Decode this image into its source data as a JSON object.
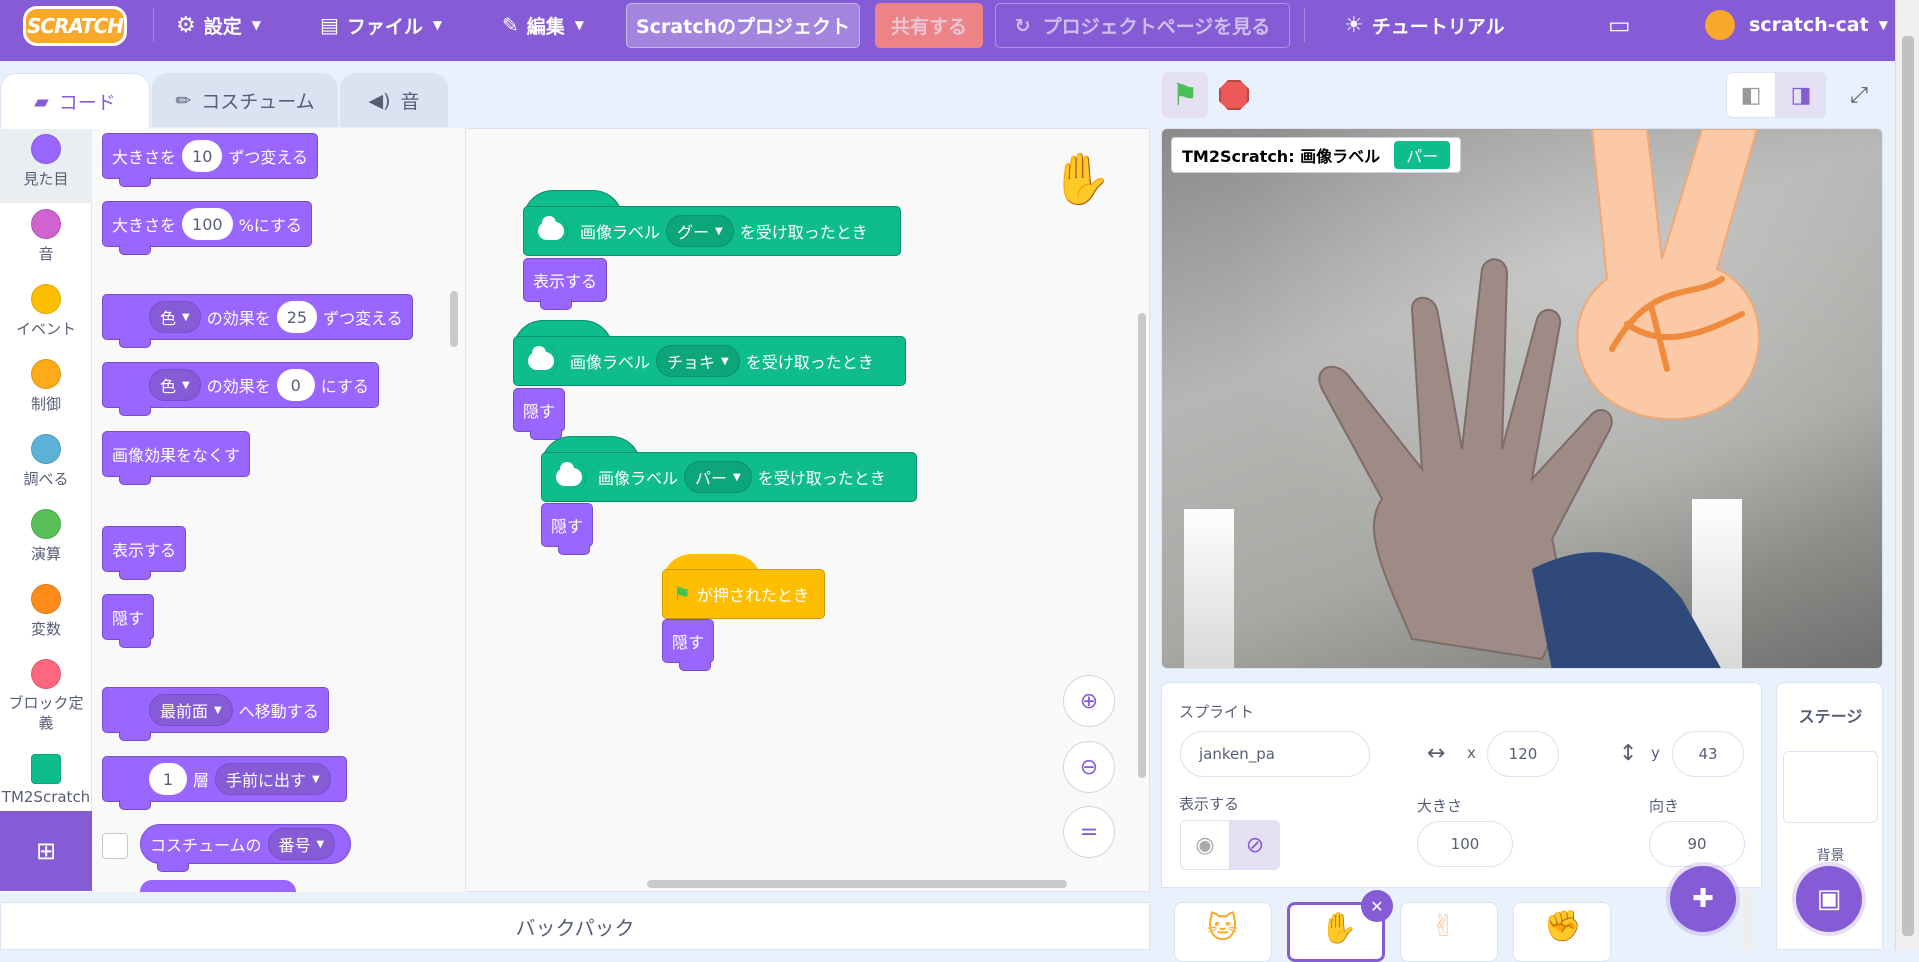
{
  "menu": {
    "logo": "SCRATCH",
    "settings": "設定",
    "file": "ファイル",
    "edit": "編集",
    "project_title": "Scratchのプロジェクト",
    "share": "共有する",
    "see_project_page": "プロジェクトページを見る",
    "tutorials": "チュートリアル",
    "username": "scratch-cat"
  },
  "tabs": {
    "code": "コード",
    "costumes": "コスチューム",
    "sound": "音"
  },
  "categories": [
    {
      "label": "見た目",
      "color": "#9966ff"
    },
    {
      "label": "音",
      "color": "#cf63cf"
    },
    {
      "label": "イベント",
      "color": "#ffbf00"
    },
    {
      "label": "制御",
      "color": "#ffab19"
    },
    {
      "label": "調べる",
      "color": "#5cb1d6"
    },
    {
      "label": "演算",
      "color": "#59c059"
    },
    {
      "label": "変数",
      "color": "#ff8c1a"
    },
    {
      "label": "ブロック定義",
      "color": "#ff6680"
    },
    {
      "label": "TM2Scratch",
      "color": "#0fbd8c"
    }
  ],
  "palette": {
    "change_size_a": "大きさを",
    "change_size_val": "10",
    "change_size_b": "ずつ変える",
    "set_size_a": "大きさを",
    "set_size_val": "100",
    "set_size_b": "%にする",
    "change_effect_dropdown": "色",
    "change_effect_a": "の効果を",
    "change_effect_val": "25",
    "change_effect_b": "ずつ変える",
    "set_effect_dropdown": "色",
    "set_effect_a": "の効果を",
    "set_effect_val": "0",
    "set_effect_b": "にする",
    "clear_effects": "画像効果をなくす",
    "show": "表示する",
    "hide": "隠す",
    "go_to_layer_dropdown": "最前面",
    "go_to_layer_b": "へ移動する",
    "go_layers_val": "1",
    "go_layers_a": "層",
    "go_layers_dropdown": "手前に出す",
    "costume_a": "コスチュームの",
    "costume_dropdown": "番号"
  },
  "scripts": {
    "hat_prefix": "画像ラベル",
    "hat_suffix": "を受け取ったとき",
    "label_goo": "グー",
    "label_choki": "チョキ",
    "label_paa": "パー",
    "show": "表示する",
    "hide": "隠す",
    "flag_hat": "が押されたとき"
  },
  "backpack": "バックパック",
  "stage": {
    "monitor_label": "TM2Scratch: 画像ラベル",
    "monitor_value": "パー"
  },
  "sprite_info": {
    "sprite_label": "スプライト",
    "sprite_name": "janken_pa",
    "x_label": "x",
    "x_value": "120",
    "y_label": "y",
    "y_value": "43",
    "show_label": "表示する",
    "size_label": "大きさ",
    "size_value": "100",
    "direction_label": "向き",
    "direction_value": "90"
  },
  "stage_pane": {
    "title": "ステージ",
    "backdrop_label": "背景"
  },
  "colors": {
    "menu_bar": "#855cd6",
    "looks": "#9966ff",
    "extension": "#0fbd8c",
    "events": "#ffbf00"
  }
}
